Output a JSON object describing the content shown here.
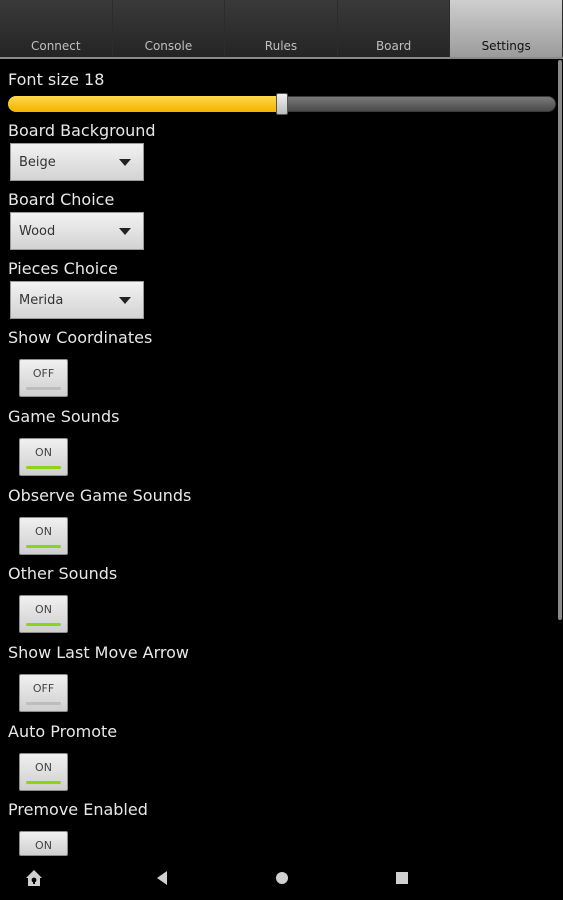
{
  "tabs": [
    "Connect",
    "Console",
    "Rules",
    "Board",
    "Settings"
  ],
  "active_tab": 4,
  "settings": {
    "font_size_label": "Font size 18",
    "font_size_fraction": 0.5,
    "board_background": {
      "label": "Board Background",
      "value": "Beige"
    },
    "board_choice": {
      "label": "Board Choice",
      "value": "Wood"
    },
    "pieces_choice": {
      "label": "Pieces Choice",
      "value": "Merida"
    },
    "toggles": [
      {
        "label": "Show Coordinates",
        "state": "OFF"
      },
      {
        "label": "Game Sounds",
        "state": "ON"
      },
      {
        "label": "Observe Game Sounds",
        "state": "ON"
      },
      {
        "label": "Other Sounds",
        "state": "ON"
      },
      {
        "label": "Show Last Move Arrow",
        "state": "OFF"
      },
      {
        "label": "Auto Promote",
        "state": "ON"
      },
      {
        "label": "Premove Enabled",
        "state": "ON"
      }
    ]
  },
  "colors": {
    "slider_fill": "#f3b200",
    "toggle_on_indicator": "#8ed31a"
  },
  "nav_icons": [
    "home-icon",
    "back-icon",
    "home-circle-icon",
    "recents-icon"
  ]
}
